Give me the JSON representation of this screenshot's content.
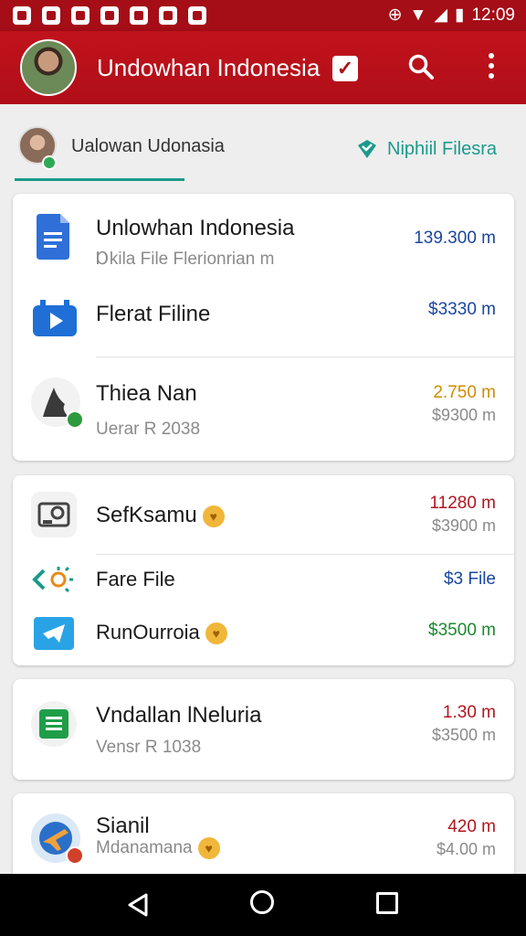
{
  "status_bar": {
    "time": "12:09"
  },
  "app_bar": {
    "title": "Undowhan Indonesia"
  },
  "tabs": {
    "left_label": "Ualowan Udonasia",
    "right_label": "Niphiil Filesra"
  },
  "cards": [
    {
      "rows": [
        {
          "title": "Unlowhan Indonesia",
          "subtitle": "Ɒkila File Flerionrian m",
          "value": "139.300 m",
          "value_color": "#1a47a0",
          "icon": "google-docs-icon"
        },
        {
          "title": "Flerat Filine",
          "value": "$3330 m",
          "value_color": "#1a47a0",
          "icon": "video-player-icon"
        },
        {
          "title": "Thiea Nan",
          "subtitle": "Uerar R 2038",
          "value": "2.750 m",
          "value_color": "#d08c00",
          "value2": "$9300 m",
          "icon": "shark-fin-icon"
        }
      ]
    },
    {
      "rows": [
        {
          "title": "SefKsamu",
          "value": "11280 m",
          "value_color": "#b3151f",
          "value2": "$3900 m",
          "icon": "camera-icon",
          "badge": true
        },
        {
          "title": "Fare File",
          "value": "$3 File",
          "value_color": "#1a47a0",
          "icon": "code-sun-icon"
        },
        {
          "title": "RunOurroia",
          "value": "$3500 m",
          "value_color": "#1b8a2e",
          "icon": "telegram-icon",
          "badge": true
        }
      ]
    },
    {
      "rows": [
        {
          "title": "Vndallan lNeluria",
          "subtitle": "Vensr R 1038",
          "value": "1.30 m",
          "value_color": "#b3151f",
          "value2": "$3500 m",
          "icon": "google-sheets-icon"
        }
      ]
    },
    {
      "rows": [
        {
          "title": "Sianil",
          "subtitle": "Mdanamana",
          "value": "420 m",
          "value_color": "#b3151f",
          "value2": "$4.00 m",
          "icon": "plane-globe-icon",
          "badge": true
        }
      ]
    }
  ],
  "colors": {
    "brand": "#b00f18",
    "accent": "#1b9a8c"
  }
}
